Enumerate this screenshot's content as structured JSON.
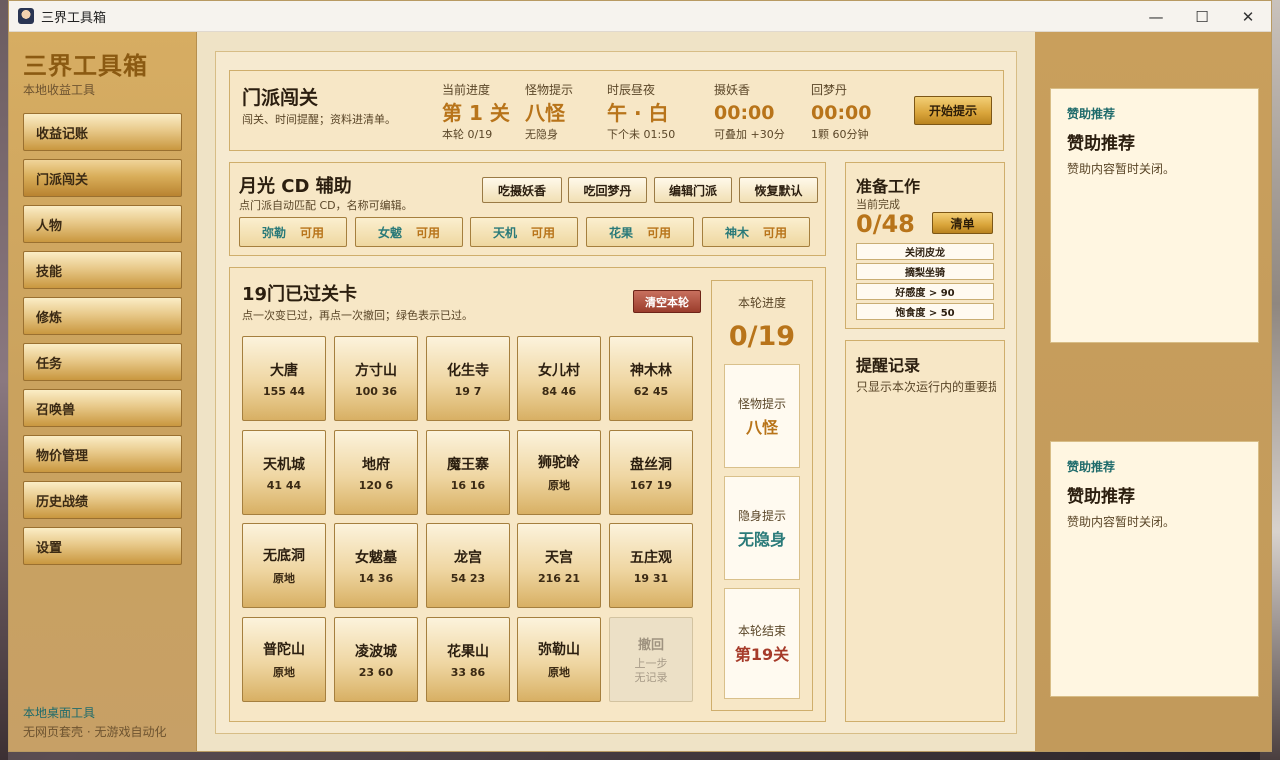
{
  "window": {
    "title": "三界工具箱",
    "controls": {
      "minimize": "—",
      "maximize": "☐",
      "close": "✕"
    }
  },
  "sidebar": {
    "brand": "三界工具箱",
    "brand_sub": "本地收益工具",
    "items": [
      {
        "label": "收益记账"
      },
      {
        "label": "门派闯关"
      },
      {
        "label": "人物"
      },
      {
        "label": "技能"
      },
      {
        "label": "修炼"
      },
      {
        "label": "任务"
      },
      {
        "label": "召唤兽"
      },
      {
        "label": "物价管理"
      },
      {
        "label": "历史战绩"
      },
      {
        "label": "设置"
      }
    ],
    "active_index": 1,
    "footer_link": "本地桌面工具",
    "footer_note": "无网页套壳 · 无游戏自动化"
  },
  "top": {
    "title": "门派闯关",
    "subtitle": "闯关、时间提醒；资料进清单。",
    "stats": [
      {
        "label": "当前进度",
        "value": "第 1 关",
        "note": "本轮 0/19"
      },
      {
        "label": "怪物提示",
        "value": "八怪",
        "note": "无隐身"
      },
      {
        "label": "时辰昼夜",
        "value": "午 · 白",
        "note": "下个未 01:50"
      },
      {
        "label": "摄妖香",
        "value": "00:00",
        "note": "可叠加 +30分"
      },
      {
        "label": "回梦丹",
        "value": "00:00",
        "note": "1颗 60分钟"
      }
    ],
    "start_button": "开始提示"
  },
  "cd": {
    "title": "月光 CD 辅助",
    "subtitle": "点门派自动匹配 CD，名称可编辑。",
    "buttons": [
      "吃摄妖香",
      "吃回梦丹",
      "编辑门派",
      "恢复默认"
    ],
    "items": [
      {
        "name": "弥勒",
        "status": "可用"
      },
      {
        "name": "女魃",
        "status": "可用"
      },
      {
        "name": "天机",
        "status": "可用"
      },
      {
        "name": "花果",
        "status": "可用"
      },
      {
        "name": "神木",
        "status": "可用"
      }
    ]
  },
  "gates": {
    "title": "19门已过关卡",
    "subtitle": "点一次变已过，再点一次撤回；绿色表示已过。",
    "clear_button": "清空本轮",
    "items": [
      {
        "name": "大唐",
        "value": "155 44"
      },
      {
        "name": "方寸山",
        "value": "100 36"
      },
      {
        "name": "化生寺",
        "value": "19 7"
      },
      {
        "name": "女儿村",
        "value": "84 46"
      },
      {
        "name": "神木林",
        "value": "62 45"
      },
      {
        "name": "天机城",
        "value": "41 44"
      },
      {
        "name": "地府",
        "value": "120 6"
      },
      {
        "name": "魔王寨",
        "value": "16 16"
      },
      {
        "name": "狮驼岭",
        "value": "原地"
      },
      {
        "name": "盘丝洞",
        "value": "167 19"
      },
      {
        "name": "无底洞",
        "value": "原地"
      },
      {
        "name": "女魃墓",
        "value": "14 36"
      },
      {
        "name": "龙宫",
        "value": "54 23"
      },
      {
        "name": "天宫",
        "value": "216 21"
      },
      {
        "name": "五庄观",
        "value": "19 31"
      },
      {
        "name": "普陀山",
        "value": "原地"
      },
      {
        "name": "凌波城",
        "value": "23 60"
      },
      {
        "name": "花果山",
        "value": "33 86"
      },
      {
        "name": "弥勒山",
        "value": "原地"
      }
    ],
    "undo": {
      "title": "撤回",
      "line1": "上一步",
      "line2": "无记录"
    },
    "progress": {
      "label": "本轮进度",
      "value": "0/19",
      "boxes": [
        {
          "label": "怪物提示",
          "value": "八怪",
          "color": "#b8741a"
        },
        {
          "label": "隐身提示",
          "value": "无隐身",
          "color": "#2a7a79"
        },
        {
          "label": "本轮结束",
          "value": "第19关",
          "color": "#a63b2a"
        }
      ]
    }
  },
  "prep": {
    "title": "准备工作",
    "subtitle": "当前完成",
    "count": "0/48",
    "button": "清单",
    "items": [
      "关闭皮龙",
      "摘梨坐骑",
      "好感度 > 90",
      "饱食度 > 50"
    ]
  },
  "log": {
    "title": "提醒记录",
    "subtitle": "只显示本次运行内的重要提醒"
  },
  "sponsors": [
    {
      "tag": "赞助推荐",
      "title": "赞助推荐",
      "text": "赞助内容暂时关闭。"
    },
    {
      "tag": "赞助推荐",
      "title": "赞助推荐",
      "text": "赞助内容暂时关闭。"
    }
  ]
}
